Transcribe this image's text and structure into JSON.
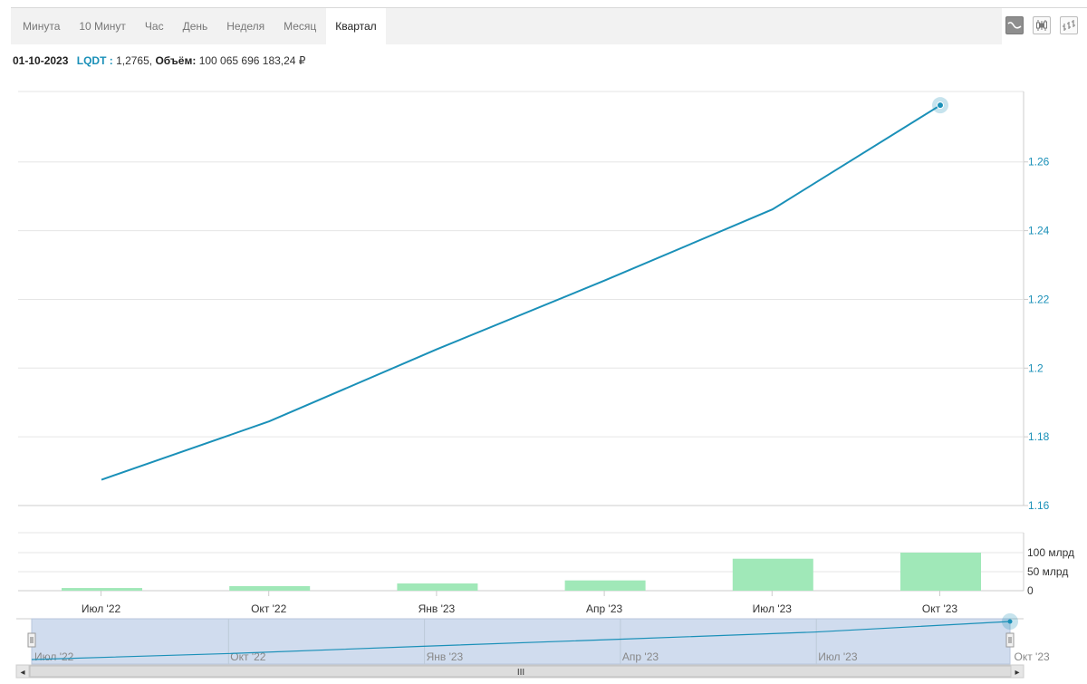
{
  "tabs": [
    {
      "label": "Минута",
      "active": false
    },
    {
      "label": "10 Минут",
      "active": false
    },
    {
      "label": "Час",
      "active": false
    },
    {
      "label": "День",
      "active": false
    },
    {
      "label": "Неделя",
      "active": false
    },
    {
      "label": "Месяц",
      "active": false
    },
    {
      "label": "Квартал",
      "active": true
    }
  ],
  "toolbar": {
    "icons": [
      "line-chart-icon",
      "candlestick-icon",
      "ohlc-bars-icon"
    ],
    "active": "line-chart-icon"
  },
  "info": {
    "date": "01-10-2023",
    "ticker": "LQDT :",
    "price": "1,2765,",
    "volume_label": "Объём:",
    "volume_value": "100 065 696 183,24 ₽"
  },
  "colors": {
    "line": "#1a90b8",
    "volume": "#a0e8b8",
    "navigator_fill": "#d0dcee",
    "grid": "#e6e6e6"
  },
  "chart_data": [
    {
      "type": "line",
      "series": [
        {
          "name": "LQDT",
          "values": [
            1.1675,
            1.1845,
            1.2055,
            1.2255,
            1.2462,
            1.2765
          ]
        }
      ],
      "x": [
        "Jul 2022",
        "Oct 2022",
        "Jan 2023",
        "Apr 2023",
        "Jul 2023",
        "Oct 2023"
      ],
      "xlabels": [
        "Июл '22",
        "Окт '22",
        "Янв '23",
        "Апр '23",
        "Июл '23",
        "Окт '23"
      ],
      "yticks": [
        "1.16",
        "1.18",
        "1.2",
        "1.22",
        "1.24",
        "1.26"
      ],
      "ylim": [
        1.16,
        1.2805
      ],
      "axis_side": "right",
      "grid": true,
      "highlighted_point": "Oct 2023"
    },
    {
      "type": "bar",
      "categories": [
        "Июл '22",
        "Окт '22",
        "Янв '23",
        "Апр '23",
        "Июл '23",
        "Окт '23"
      ],
      "values": [
        7,
        12,
        19,
        27,
        84,
        100
      ],
      "unit": "млрд",
      "yticks": [
        "0",
        "50 млрд",
        "100 млрд"
      ],
      "ylim": [
        0,
        100
      ]
    }
  ],
  "navigator": {
    "labels": [
      "Июл '22",
      "Окт '22",
      "Янв '23",
      "Апр '23",
      "Июл '23",
      "Окт '23"
    ],
    "scrollbar_grip": "III",
    "left_arrow": "◂",
    "right_arrow": "▸"
  }
}
